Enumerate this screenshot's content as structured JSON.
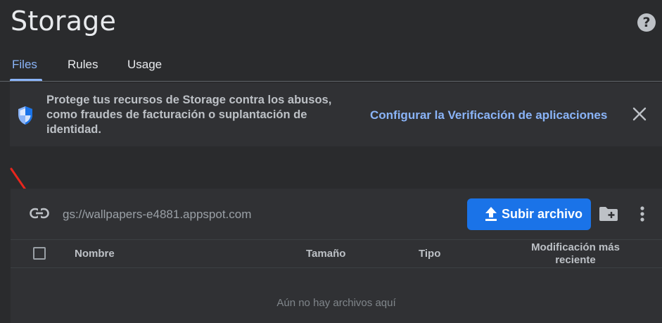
{
  "header": {
    "title": "Storage",
    "help_icon": "help-icon",
    "help_glyph": "?"
  },
  "tabs": [
    {
      "label": "Files",
      "active": true
    },
    {
      "label": "Rules",
      "active": false
    },
    {
      "label": "Usage",
      "active": false
    }
  ],
  "banner": {
    "icon": "shield-icon",
    "message": "Protege tus recursos de Storage contra los abusos, como fraudes de facturación o suplantación de identidad.",
    "link_label": "Configurar la Verificación de aplicaciones",
    "close_icon": "close-icon"
  },
  "files_panel": {
    "link_icon": "link-icon",
    "bucket_path": "gs://wallpapers-e4881.appspot.com",
    "upload_label": "Subir archivo",
    "upload_icon": "upload-icon",
    "new_folder_icon": "create-folder-icon",
    "more_icon": "more-vert-icon",
    "columns": [
      "Nombre",
      "Tamaño",
      "Tipo",
      "Modificación más reciente"
    ],
    "empty_message": "Aún no hay archivos aquí"
  },
  "colors": {
    "background": "#2a2b2d",
    "accent": "#8ab4f8",
    "primary_button": "#1a73e8",
    "annotation_arrow": "#e8261d"
  }
}
